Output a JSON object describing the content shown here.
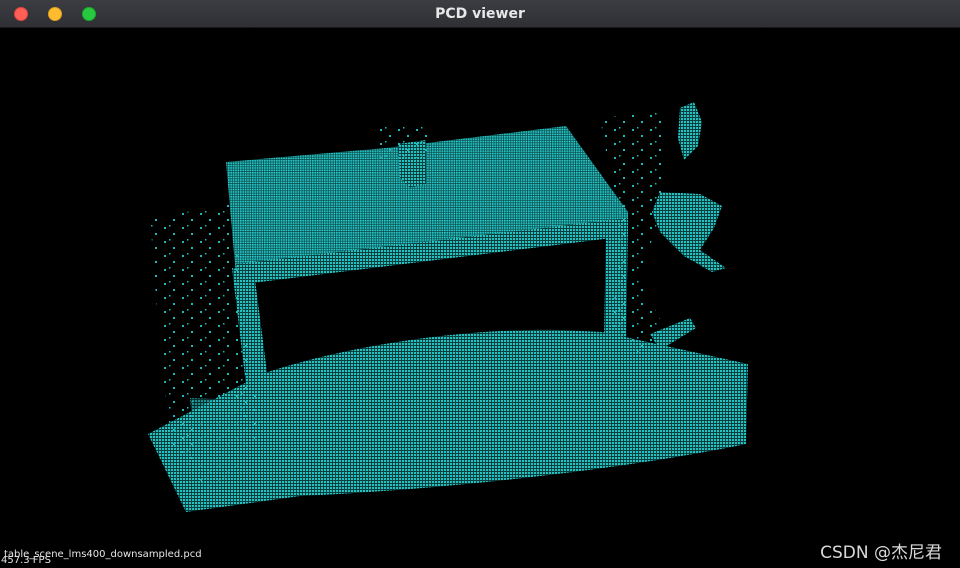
{
  "window": {
    "title": "PCD viewer"
  },
  "viewer": {
    "filename": "table_scene_lms400_downsampled.pcd",
    "fps": "457.3 FPS",
    "point_color": "#1fb8b8",
    "background_color": "#000000"
  },
  "watermark": {
    "text": "CSDN @杰尼君"
  }
}
